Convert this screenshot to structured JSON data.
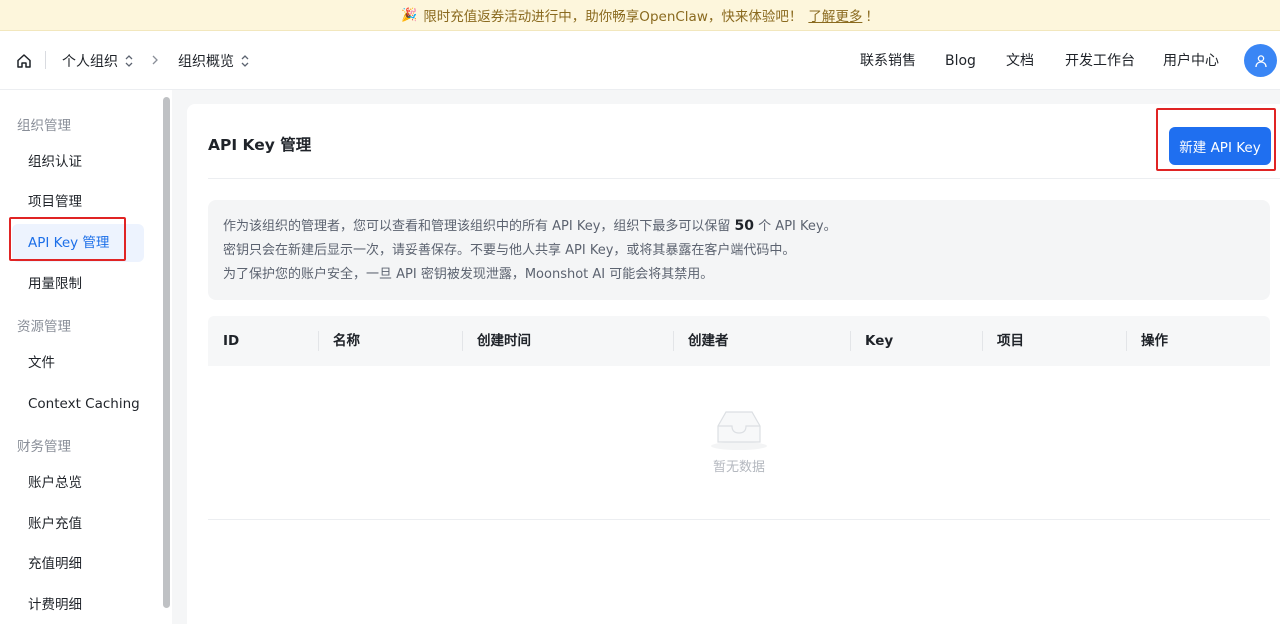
{
  "banner": {
    "text": "限时充值返券活动进行中，助你畅享OpenClaw，快来体验吧！",
    "link": "了解更多",
    "tail": "！"
  },
  "header": {
    "breadcrumb": [
      "个人组织",
      "组织概览"
    ],
    "nav": [
      "联系销售",
      "Blog",
      "文档",
      "开发工作台",
      "用户中心"
    ]
  },
  "sidebar": {
    "groups": [
      {
        "label": "组织管理",
        "items": [
          "组织认证",
          "项目管理",
          "API Key 管理",
          "用量限制"
        ]
      },
      {
        "label": "资源管理",
        "items": [
          "文件",
          "Context Caching"
        ]
      },
      {
        "label": "财务管理",
        "items": [
          "账户总览",
          "账户充值",
          "充值明细",
          "计费明细"
        ]
      }
    ],
    "active_item": "API Key 管理"
  },
  "main": {
    "title": "API Key 管理",
    "new_button": "新建 API Key",
    "notice": {
      "line1_pre": "作为该组织的管理者，您可以查看和管理该组织中的所有 API Key，组织下最多可以保留",
      "line1_num": "50",
      "line1_post": "个 API Key。",
      "line2": "密钥只会在新建后显示一次，请妥善保存。不要与他人共享 API Key，或将其暴露在客户端代码中。",
      "line3": "为了保护您的账户安全，一旦 API 密钥被发现泄露，Moonshot AI 可能会将其禁用。"
    },
    "table": {
      "columns": [
        "ID",
        "名称",
        "创建时间",
        "创建者",
        "Key",
        "项目",
        "操作"
      ],
      "empty_text": "暂无数据"
    }
  },
  "colors": {
    "accent": "#1f6ff0",
    "highlight": "#e02424",
    "banner_bg": "#fdf6dc",
    "avatar": "#3a86f5"
  }
}
